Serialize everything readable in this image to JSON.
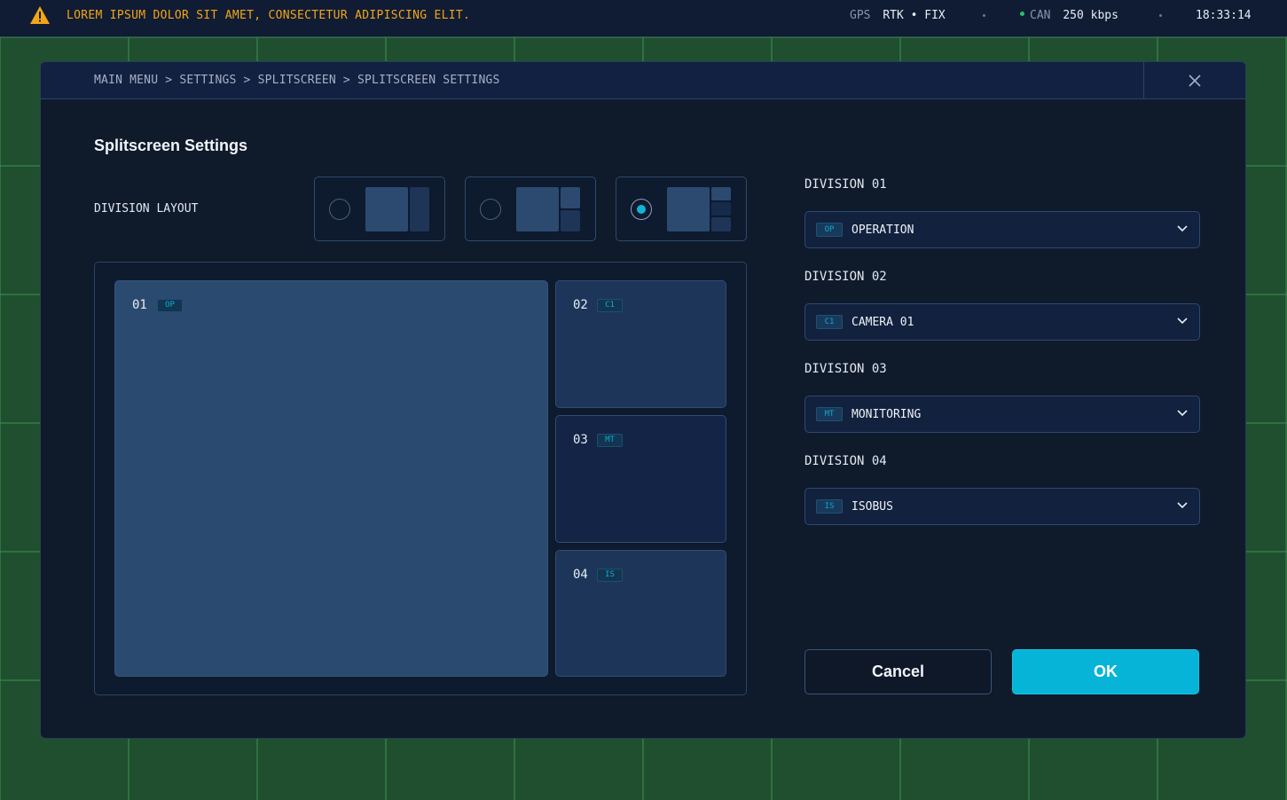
{
  "topbar": {
    "warning_text": "LOREM IPSUM DOLOR SIT AMET, CONSECTETUR ADIPISCING ELIT.",
    "gps_label": "GPS",
    "gps_value": "RTK • FIX",
    "can_label": "CAN",
    "can_value": "250 kbps",
    "time": "18:33:14",
    "warning_color": "#f2a516",
    "can_status_color": "#27c26a"
  },
  "dialog": {
    "breadcrumb": "MAIN MENU > SETTINGS > SPLITSCREEN > SPLITSCREEN SETTINGS",
    "title": "Splitscreen Settings",
    "division_layout_label": "DIVISION LAYOUT",
    "layout_options": [
      {
        "name": "two-pane",
        "selected": false
      },
      {
        "name": "three-pane",
        "selected": false
      },
      {
        "name": "four-pane",
        "selected": true
      }
    ],
    "preview": [
      {
        "num": "01",
        "badge": "OP"
      },
      {
        "num": "02",
        "badge": "C1"
      },
      {
        "num": "03",
        "badge": "MT"
      },
      {
        "num": "04",
        "badge": "IS"
      }
    ],
    "divisions": [
      {
        "label": "DIVISION 01",
        "badge": "OP",
        "value": "OPERATION"
      },
      {
        "label": "DIVISION 02",
        "badge": "C1",
        "value": "CAMERA 01"
      },
      {
        "label": "DIVISION 03",
        "badge": "MT",
        "value": "MONITORING"
      },
      {
        "label": "DIVISION 04",
        "badge": "IS",
        "value": "ISOBUS"
      }
    ],
    "cancel_label": "Cancel",
    "ok_label": "OK",
    "accent_color": "#06b4d8",
    "icons": {
      "warning": "warning-icon",
      "close": "close-icon",
      "chevron": "chevron-down-icon"
    }
  }
}
